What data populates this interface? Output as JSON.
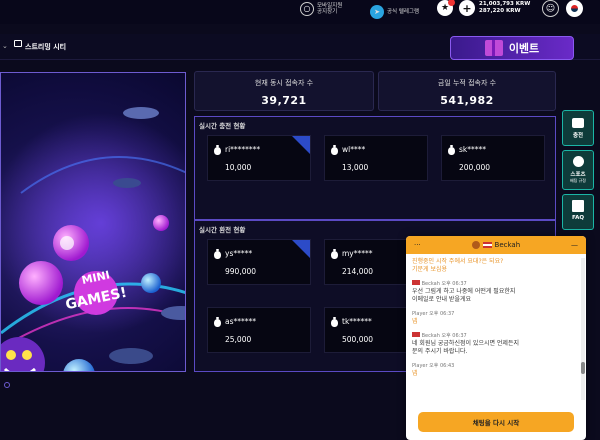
{
  "topbar": {
    "support_label_1": "모바일지원",
    "support_label_2": "공지창기",
    "telegram_label": "공식 텔레그램",
    "balance_1": "21,003,793 KRW",
    "balance_2": "287,220 KRW"
  },
  "nav": {
    "item_label": "스트리밍 시티"
  },
  "event_button": {
    "label": "이벤트"
  },
  "stats": {
    "concurrent_label": "현재 동시 접속자 수",
    "concurrent_value": "39,721",
    "cumulative_label": "금일 누적 접속자 수",
    "cumulative_value": "541,982"
  },
  "deposit_section": {
    "title": "실시간 충전 현황",
    "cards": [
      {
        "user": "ri********",
        "amount": "10,000"
      },
      {
        "user": "wl****",
        "amount": "13,000"
      },
      {
        "user": "sk*****",
        "amount": "200,000"
      }
    ]
  },
  "withdraw_section": {
    "title": "실시간 환전 현황",
    "cards": [
      {
        "user": "ys*****",
        "amount": "990,000"
      },
      {
        "user": "my*****",
        "amount": "214,000"
      },
      {
        "user": "as******",
        "amount": "25,000"
      },
      {
        "user": "tk******",
        "amount": "500,000"
      }
    ]
  },
  "side": {
    "deposit": "충전",
    "sports": "스포츠",
    "sports_sub": "배팅 규정",
    "faq": "FAQ"
  },
  "chat": {
    "agent_name": "Beckah",
    "msg1_text_1": "진행중인 시작 주에서 요대?은 되요?",
    "msg1_text_2": "기문게 보심용",
    "msg2_meta": "Beckah 오후 06:37",
    "msg2_text_1": "우선 그림게 하고 나중에 어떤게 필요한지",
    "msg2_text_2": "이메일로 안내 받을게요",
    "msg3_meta": "Player 오후 06:37",
    "msg3_text": "넵",
    "msg4_meta": "Beckah 오후 06:37",
    "msg4_text_1": "네 회원님 궁금하신점이 있으시면 언제든지",
    "msg4_text_2": "문의 주시기 바랍니다.",
    "msg5_meta": "Player 오후 06:43",
    "msg5_text": "넵",
    "restart_label": "채팅을 다시 시작"
  }
}
